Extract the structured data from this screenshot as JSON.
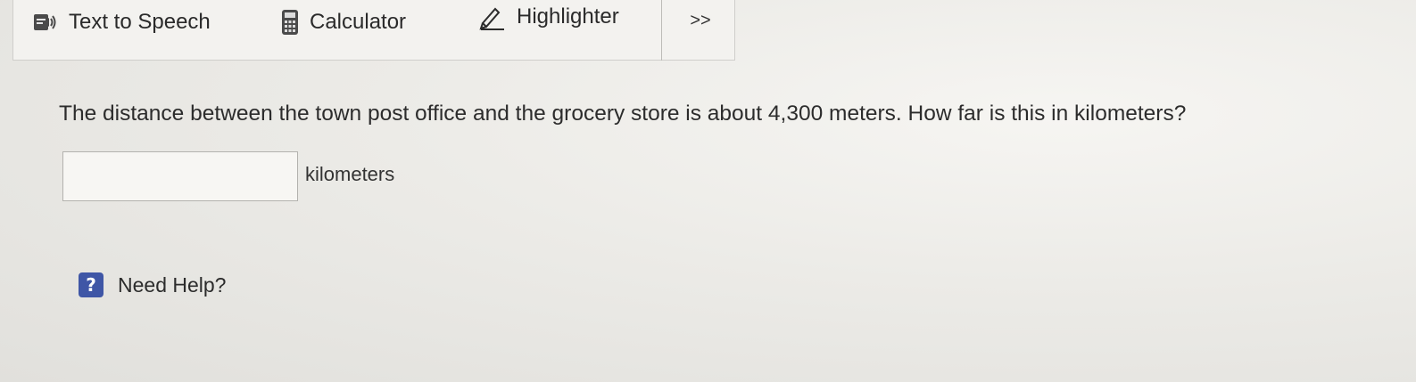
{
  "toolbar": {
    "text_to_speech_label": "Text to Speech",
    "calculator_label": "Calculator",
    "highlighter_label": "Highlighter",
    "more_label": ">>"
  },
  "question": {
    "text": "The distance between the town post office and the grocery store is about 4,300 meters. How far is this in kilometers?",
    "answer_value": "",
    "unit": "kilometers"
  },
  "help": {
    "icon_glyph": "?",
    "label": "Need Help?"
  },
  "icons": {
    "text_to_speech": "speaker-icon",
    "calculator": "calculator-icon",
    "highlighter": "highlighter-pen-icon",
    "help": "help-question-icon"
  },
  "colors": {
    "help_icon": "#3f56a6"
  }
}
